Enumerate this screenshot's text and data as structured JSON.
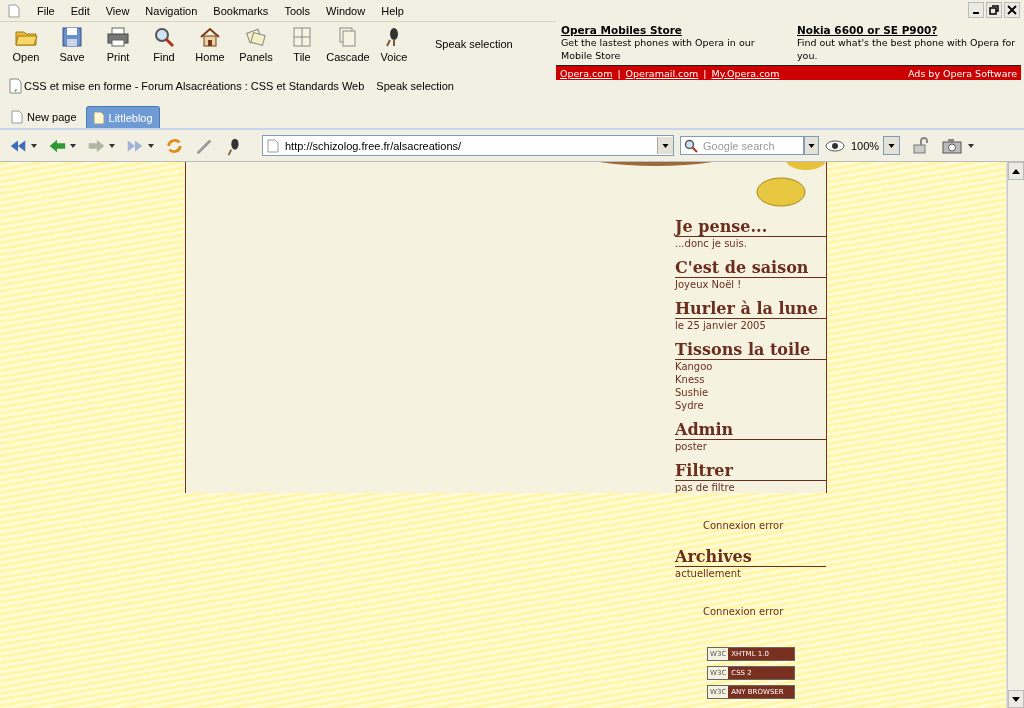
{
  "menu": [
    "File",
    "Edit",
    "View",
    "Navigation",
    "Bookmarks",
    "Tools",
    "Window",
    "Help"
  ],
  "toolbar": [
    "Open",
    "Save",
    "Print",
    "Find",
    "Home",
    "Panels",
    "Tile",
    "Cascade",
    "Voice"
  ],
  "toolbar_extra": "Speak selection",
  "bookmarks": [
    {
      "label": "CSS et mise en forme - Forum Alsacréations : CSS et Standards Web"
    }
  ],
  "bookmarks_extra": "Speak selection",
  "ad": {
    "blocks": [
      {
        "title": "Opera Mobiles Store",
        "text": "Get the lastest phones with Opera in our Mobile Store"
      },
      {
        "title": "Nokia 6600 or SE P900?",
        "text": "Find out what's the best phone with Opera for you."
      }
    ],
    "links": [
      "Opera.com",
      "Operamail.com",
      "My.Opera.com"
    ],
    "link_separator": "|",
    "credit": "Ads by Opera Software"
  },
  "tabs": [
    {
      "label": "New page",
      "selected": false
    },
    {
      "label": "Littleblog",
      "selected": true
    }
  ],
  "address": "http://schizolog.free.fr/alsacreations/",
  "search": {
    "placeholder": "Google search"
  },
  "zoom": "100%",
  "sidebar": [
    {
      "title": "Je pense...",
      "items": [
        "...donc je suis."
      ]
    },
    {
      "title": "C'est de saison",
      "items": [
        "Joyeux Noël !"
      ]
    },
    {
      "title": "Hurler à la lune",
      "items": [
        "le 25 janvier 2005"
      ]
    },
    {
      "title": "Tissons la toile",
      "items": [
        "Kangoo",
        "Kness",
        "Sushie",
        "Sydre"
      ]
    },
    {
      "title": "Admin",
      "items": [
        "poster"
      ]
    },
    {
      "title": "Filtrer",
      "items": [
        "pas de filtre"
      ],
      "error": "Connexion error"
    },
    {
      "title": "Archives",
      "items": [
        "actuellement"
      ],
      "error": "Connexion error"
    }
  ],
  "badges": [
    {
      "logo": "W3C",
      "label": "XHTML 1.0"
    },
    {
      "logo": "W3C",
      "label": "CSS 2"
    },
    {
      "logo": "W3C",
      "label": "ANY BROWSER"
    }
  ]
}
